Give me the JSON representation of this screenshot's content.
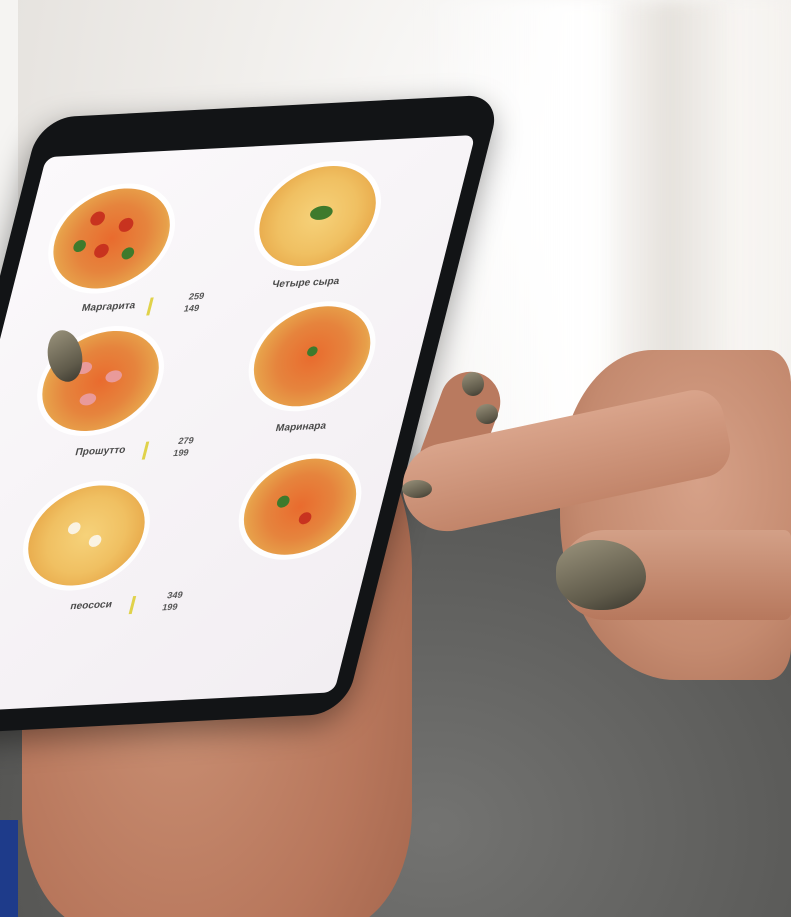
{
  "menu": {
    "items": [
      {
        "name": "Маргарита",
        "price_1": "259",
        "price_2": "149"
      },
      {
        "name": "Четыре сыра"
      },
      {
        "name": "Прошутто",
        "price_1": "279",
        "price_2": "199"
      },
      {
        "name": "Маринара"
      },
      {
        "name": "пеососи",
        "price_1": "349",
        "price_2": "199"
      },
      {
        "name": ""
      }
    ]
  },
  "colors": {
    "accent_divider": "#e0d24a",
    "phone_body": "#121416",
    "left_banner": "#1e3b8a"
  }
}
